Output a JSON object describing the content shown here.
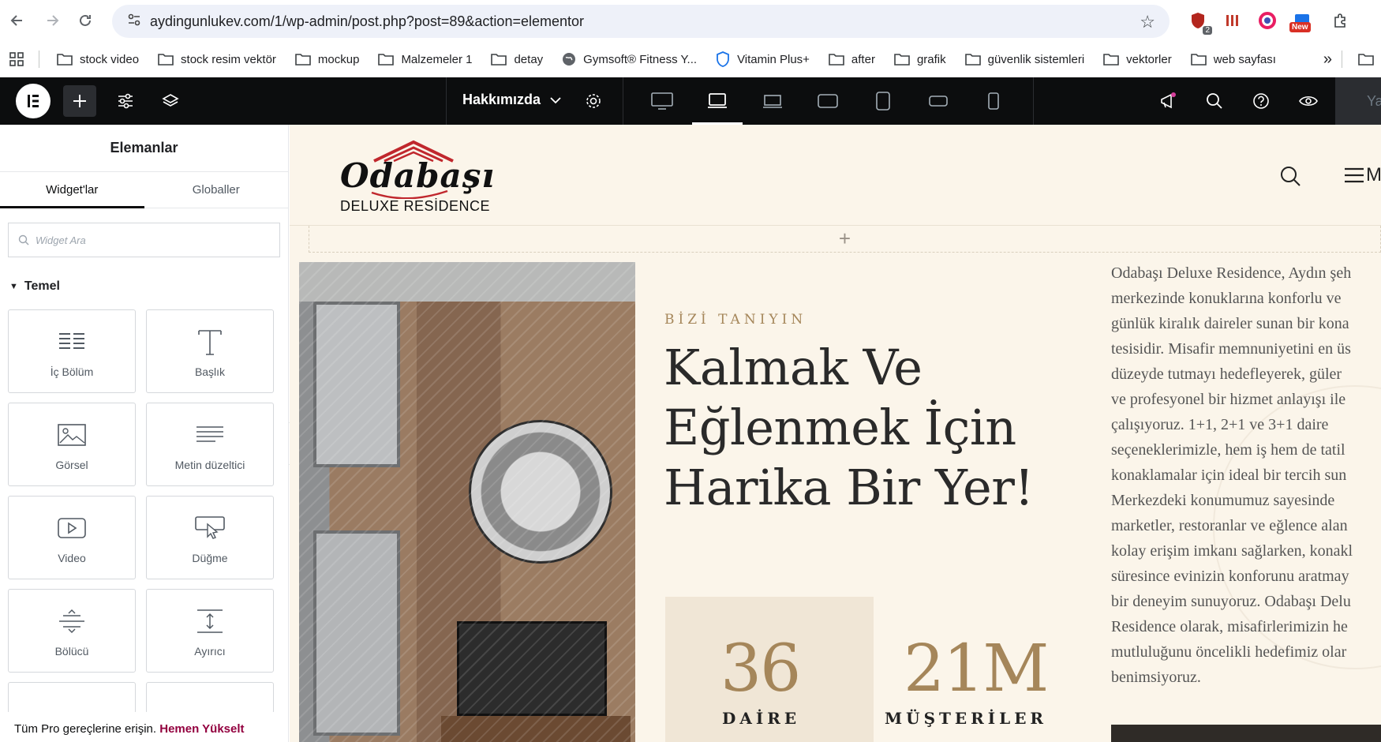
{
  "browser": {
    "url": "aydingunlukev.com/1/wp-admin/post.php?post=89&action=elementor",
    "ext_badge_count": "2",
    "ext_badge_new": "New"
  },
  "bookmarks": [
    {
      "label": "stock video",
      "icon": "folder-icon"
    },
    {
      "label": "stock resim vektör",
      "icon": "folder-icon"
    },
    {
      "label": "mockup",
      "icon": "folder-icon"
    },
    {
      "label": "Malzemeler 1",
      "icon": "folder-icon"
    },
    {
      "label": "detay",
      "icon": "folder-icon"
    },
    {
      "label": "Gymsoft® Fitness Y...",
      "icon": "globe-icon"
    },
    {
      "label": "Vitamin Plus+",
      "icon": "shield-icon"
    },
    {
      "label": "after",
      "icon": "folder-icon"
    },
    {
      "label": "grafik",
      "icon": "folder-icon"
    },
    {
      "label": "güvenlik sistemleri",
      "icon": "folder-icon"
    },
    {
      "label": "vektorler",
      "icon": "folder-icon"
    },
    {
      "label": "web sayfası",
      "icon": "folder-icon"
    }
  ],
  "editor": {
    "page_name": "Hakkımızda",
    "publish_label": "Ya"
  },
  "panel": {
    "title": "Elemanlar",
    "tabs": [
      "Widget'lar",
      "Globaller"
    ],
    "search_placeholder": "Widget Ara",
    "category": "Temel",
    "widgets": [
      {
        "label": "İç Bölüm",
        "icon": "inner-section-icon"
      },
      {
        "label": "Başlık",
        "icon": "heading-icon"
      },
      {
        "label": "Görsel",
        "icon": "image-icon"
      },
      {
        "label": "Metin düzeltici",
        "icon": "text-editor-icon"
      },
      {
        "label": "Video",
        "icon": "video-icon"
      },
      {
        "label": "Düğme",
        "icon": "button-icon"
      },
      {
        "label": "Bölücü",
        "icon": "divider-icon"
      },
      {
        "label": "Ayırıcı",
        "icon": "spacer-icon"
      }
    ],
    "promo_text": "Tüm Pro gereçlerine erişin.",
    "promo_link": "Hemen Yükselt"
  },
  "site": {
    "logo_name": "Odabaşı",
    "logo_sub": "DELUXE RESİDENCE",
    "menu_letter": "M",
    "kicker": "BİZİ TANIYIN",
    "headline": "Kalmak Ve Eğlenmek İçin Harika Bir Yer!",
    "stats": [
      {
        "value": "36",
        "label": "DAİRE"
      },
      {
        "value": "21M",
        "label": "MÜŞTERİLER"
      }
    ],
    "paragraph_lines": [
      "Odabaşı Deluxe Residence, Aydın şeh",
      "merkezinde konuklarına konforlu ve",
      "günlük kiralık daireler sunan bir kona",
      "tesisidir. Misafir memnuniyetini en üs",
      "düzeyde tutmayı hedefleyerek, güler",
      "ve profesyonel bir hizmet anlayışı ile",
      "çalışıyoruz. 1+1, 2+1 ve 3+1 daire",
      "seçeneklerimizle, hem iş hem de tatil",
      "konaklamalar için ideal bir tercih sun",
      "Merkezdeki konumumuz sayesinde",
      "marketler, restoranlar ve eğlence alan",
      "kolay erişim imkanı sağlarken, konakl",
      "süresince evinizin konforunu aratmay",
      "bir deneyim sunuyoruz. Odabaşı Delu",
      "Residence olarak, misafirlerimizin he",
      "mutluluğunu öncelikli hedefimiz olar",
      "benimsiyoruz."
    ]
  },
  "colors": {
    "accent_gold": "#a5865a",
    "canvas_bg": "#fbf5ea",
    "editor_bar": "#0c0d0e",
    "promo_link": "#93003f"
  }
}
